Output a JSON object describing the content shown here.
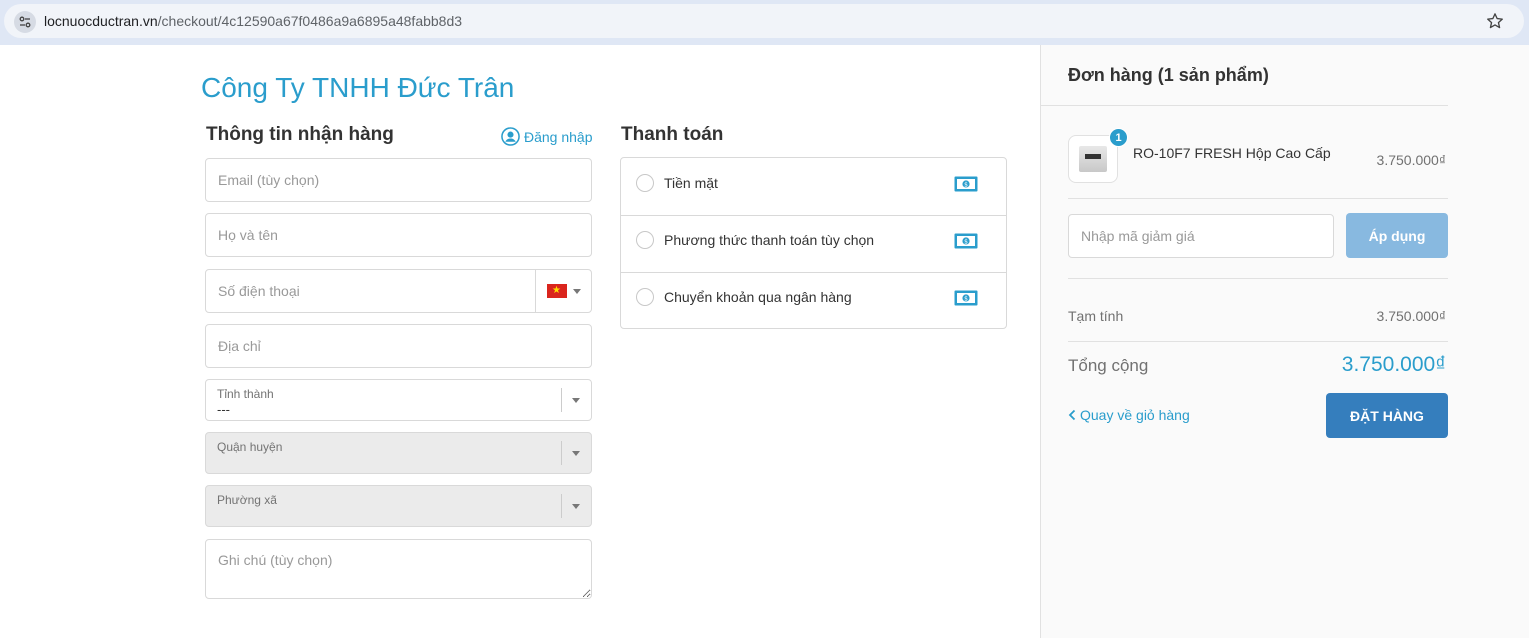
{
  "browser": {
    "url_domain": "locnuocductran.vn",
    "url_path": "/checkout/4c12590a67f0486a9a6895a48fabb8d3"
  },
  "brand": {
    "name": "Công Ty TNHH Đức Trân"
  },
  "shipping": {
    "title": "Thông tin nhận hàng",
    "login_label": "Đăng nhập",
    "email_placeholder": "Email (tùy chọn)",
    "name_placeholder": "Họ và tên",
    "phone_placeholder": "Số điện thoại",
    "address_placeholder": "Địa chỉ",
    "province": {
      "label": "Tỉnh thành",
      "value": "---"
    },
    "district": {
      "label": "Quận huyện",
      "value": ""
    },
    "ward": {
      "label": "Phường xã",
      "value": ""
    },
    "note_placeholder": "Ghi chú (tùy chọn)"
  },
  "payment": {
    "title": "Thanh toán",
    "methods": [
      {
        "label": "Tiền mặt"
      },
      {
        "label": "Phương thức thanh toán tùy chọn"
      },
      {
        "label": "Chuyển khoản qua ngân hàng"
      }
    ]
  },
  "order": {
    "title": "Đơn hàng (1 sản phẩm)",
    "item": {
      "name": "RO-10F7 FRESH Hộp Cao Cấp",
      "price": "3.750.000₫",
      "quantity": "1"
    },
    "discount_placeholder": "Nhập mã giảm giá",
    "apply_label": "Áp dụng",
    "subtotal_label": "Tạm tính",
    "subtotal_value": "3.750.000₫",
    "total_label": "Tổng cộng",
    "total_value": "3.750.000₫",
    "back_label": "Quay về giỏ hàng",
    "submit_label": "ĐẶT HÀNG"
  },
  "colors": {
    "accent": "#2a9dcc",
    "primary_button": "#357ebd",
    "disabled_button": "#88b9e0"
  }
}
